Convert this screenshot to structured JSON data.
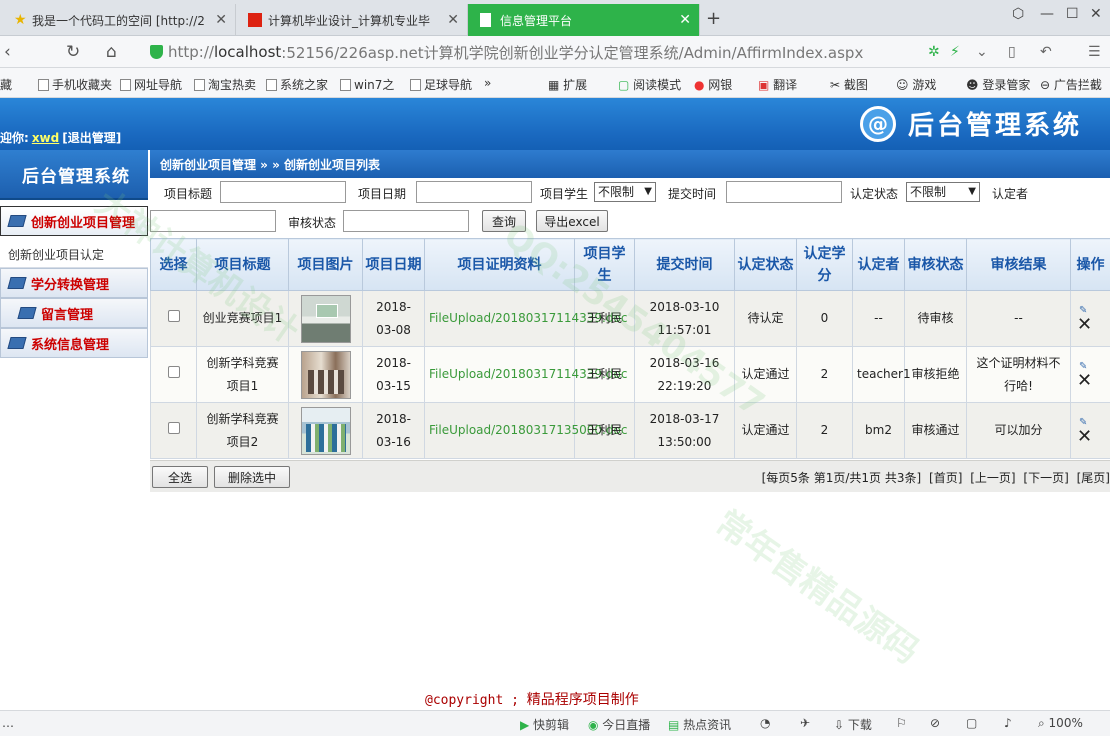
{
  "browser": {
    "tabs": [
      {
        "title": "我是一个代码工的空间 [http://2",
        "active": false
      },
      {
        "title": "计算机毕业设计_计算机专业毕",
        "active": false
      },
      {
        "title": "信息管理平台",
        "active": true
      }
    ],
    "url_prefix": "http://",
    "url_host": "localhost",
    "url_rest": ":52156/226asp.net计算机学院创新创业学分认定管理系统/Admin/AffirmIndex.aspx",
    "bookmarks": [
      "藏",
      "手机收藏夹",
      "网址导航",
      "淘宝热卖",
      "系统之家",
      "win7之",
      "足球导航",
      "»",
      "扩展",
      "阅读模式",
      "网银",
      "翻译",
      "截图",
      "游戏",
      "登录管家",
      "广告拦截"
    ]
  },
  "header": {
    "greeting": "迎你:",
    "username": "xwd",
    "logout": "[退出管理]",
    "brand": "后台管理系统",
    "brand_mark": "@"
  },
  "sidebar": {
    "title": "后台管理系统",
    "items": [
      {
        "label": "创新创业项目管理",
        "active": true
      },
      {
        "label": "创新创业项目认定",
        "sub": true
      },
      {
        "label": "学分转换管理"
      },
      {
        "label": "留言管理",
        "indent": true
      },
      {
        "label": "系统信息管理"
      }
    ]
  },
  "main": {
    "breadcrumb": "创新创业项目管理 » » 创新创业项目列表",
    "filters": {
      "title_label": "项目标题",
      "date_label": "项目日期",
      "student_label": "项目学生",
      "student_value": "不限制",
      "submit_label": "提交时间",
      "status_label": "认定状态",
      "status_value": "不限制",
      "affirmer_label": "认定者",
      "review_label": "审核状态",
      "query_button": "查询",
      "export_button": "导出excel"
    },
    "columns": [
      "选择",
      "项目标题",
      "项目图片",
      "项目日期",
      "项目证明资料",
      "项目学生",
      "提交时间",
      "认定状态",
      "认定学分",
      "认定者",
      "审核状态",
      "审核结果",
      "操作"
    ],
    "rows": [
      {
        "title": "创业竞赛项目1",
        "date": "2018-03-08",
        "file": "FileUpload/20180317114339.doc",
        "student": "王利民",
        "submit": "2018-03-10 11:57:01",
        "status": "待认定",
        "credit": "0",
        "affirmer": "--",
        "review": "待审核",
        "result": "--"
      },
      {
        "title": "创新学科竞赛项目1",
        "date": "2018-03-15",
        "file": "FileUpload/20180317114339.doc",
        "student": "王利民",
        "submit": "2018-03-16 22:19:20",
        "status": "认定通过",
        "credit": "2",
        "affirmer": "teacher1",
        "review": "审核拒绝",
        "result": "这个证明材料不行哈!"
      },
      {
        "title": "创新学科竞赛项目2",
        "date": "2018-03-16",
        "file": "FileUpload/20180317135000.doc",
        "student": "王利民",
        "submit": "2018-03-17 13:50:00",
        "status": "认定通过",
        "credit": "2",
        "affirmer": "bm2",
        "review": "审核通过",
        "result": "可以加分"
      }
    ],
    "select_all": "全选",
    "delete_selected": "删除选中",
    "pager": {
      "info": "[每页5条 第1页/共1页 共3条]",
      "first": "[首页]",
      "prev": "[上一页]",
      "next": "[下一页]",
      "last": "[尾页]"
    }
  },
  "copyright": {
    "prefix": "@copyright ; ",
    "text": "精品程序项目制作"
  },
  "statusbar": {
    "items": [
      "快剪辑",
      "今日直播",
      "热点资讯",
      "下载",
      "100%"
    ]
  },
  "watermarks": [
    "大神计算机设计",
    "QQ:2545404577",
    "常年售精品源码"
  ],
  "colors": {
    "accent_blue": "#1b5fb0",
    "active_tab": "#2eb34a",
    "header_text": "#1a57a8",
    "file_link": "#3a9a3a",
    "menu_red": "#cc0000"
  }
}
